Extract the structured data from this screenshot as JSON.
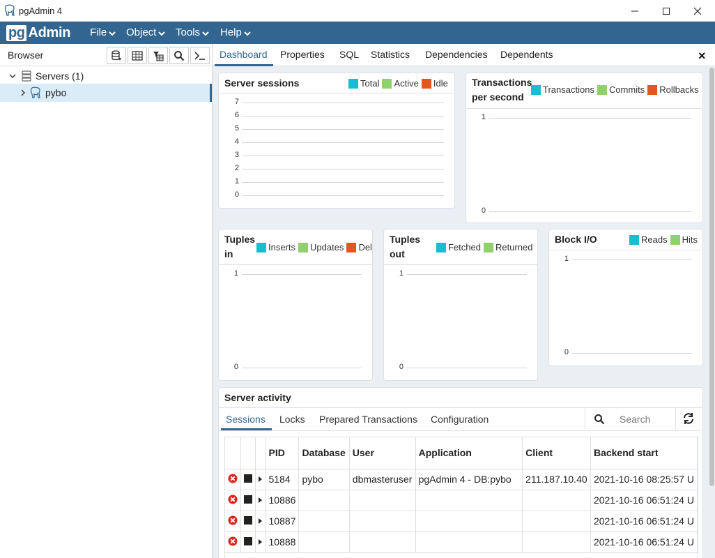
{
  "window": {
    "title": "pgAdmin 4"
  },
  "menubar": {
    "logo_pg": "pg",
    "logo_admin": "Admin",
    "items": [
      "File",
      "Object",
      "Tools",
      "Help"
    ]
  },
  "browser": {
    "title": "Browser",
    "tree": [
      {
        "label": "Servers (1)",
        "icon": "servers-icon",
        "expanded": true
      },
      {
        "label": "pybo",
        "icon": "elephant-icon",
        "expanded": false,
        "selected": true
      }
    ]
  },
  "tabs": [
    "Dashboard",
    "Properties",
    "SQL",
    "Statistics",
    "Dependencies",
    "Dependents"
  ],
  "colors": {
    "teal": "#17becf",
    "green": "#8fd16d",
    "orange": "#e5561f",
    "brand": "#326690"
  },
  "dashboard": {
    "server_sessions": {
      "title": "Server sessions",
      "legend": [
        "Total",
        "Active",
        "Idle"
      ],
      "yticks": [
        "7",
        "6",
        "5",
        "4",
        "3",
        "2",
        "1",
        "0"
      ]
    },
    "tps": {
      "title_line1": "Transactions",
      "title_line2": "per second",
      "legend": [
        "Transactions",
        "Commits",
        "Rollbacks"
      ],
      "yticks": [
        "1",
        "0"
      ]
    },
    "tuples_in": {
      "title_line1": "Tuples",
      "title_line2": "in",
      "legend": [
        "Inserts",
        "Updates",
        "Deletes"
      ],
      "yticks": [
        "1",
        "0"
      ]
    },
    "tuples_out": {
      "title_line1": "Tuples",
      "title_line2": "out",
      "legend": [
        "Fetched",
        "Returned"
      ],
      "yticks": [
        "1",
        "0"
      ]
    },
    "block_io": {
      "title": "Block I/O",
      "legend": [
        "Reads",
        "Hits"
      ],
      "yticks": [
        "1",
        "0"
      ]
    }
  },
  "activity": {
    "title": "Server activity",
    "tabs": [
      "Sessions",
      "Locks",
      "Prepared Transactions",
      "Configuration"
    ],
    "search_placeholder": "Search",
    "columns": [
      "PID",
      "Database",
      "User",
      "Application",
      "Client",
      "Backend start"
    ],
    "rows": [
      {
        "pid": "5184",
        "database": "pybo",
        "user": "dbmasteruser",
        "application": "pgAdmin 4 - DB:pybo",
        "client": "211.187.10.40",
        "backend_start": "2021-10-16 08:25:57 U"
      },
      {
        "pid": "10886",
        "database": "",
        "user": "",
        "application": "",
        "client": "",
        "backend_start": "2021-10-16 06:51:24 U"
      },
      {
        "pid": "10887",
        "database": "",
        "user": "",
        "application": "",
        "client": "",
        "backend_start": "2021-10-16 06:51:24 U"
      },
      {
        "pid": "10888",
        "database": "",
        "user": "",
        "application": "",
        "client": "",
        "backend_start": "2021-10-16 06:51:24 U"
      }
    ]
  }
}
